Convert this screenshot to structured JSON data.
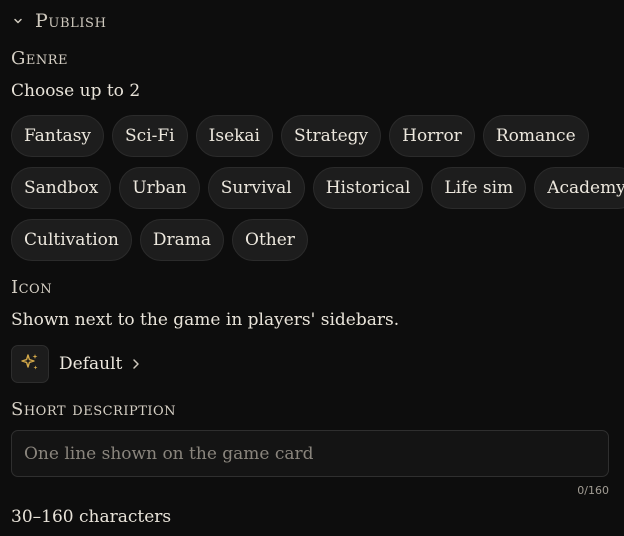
{
  "section": {
    "title": "Publish",
    "collapse_icon": "chevron-down-icon"
  },
  "genre": {
    "label": "Genre",
    "help": "Choose up to 2",
    "options": [
      "Fantasy",
      "Sci-Fi",
      "Isekai",
      "Strategy",
      "Horror",
      "Romance",
      "Sandbox",
      "Urban",
      "Survival",
      "Historical",
      "Life sim",
      "Academy",
      "Cultivation",
      "Drama",
      "Other"
    ]
  },
  "icon": {
    "label": "Icon",
    "help": "Shown next to the game in players' sidebars.",
    "selected": "Default",
    "preview_icon": "sparkles-icon",
    "arrow_icon": "chevron-right-icon",
    "accent_color": "#d4a94a"
  },
  "short_description": {
    "label": "Short description",
    "placeholder": "One line shown on the game card",
    "value": "",
    "counter": "0/160",
    "note": "30–160 characters"
  }
}
